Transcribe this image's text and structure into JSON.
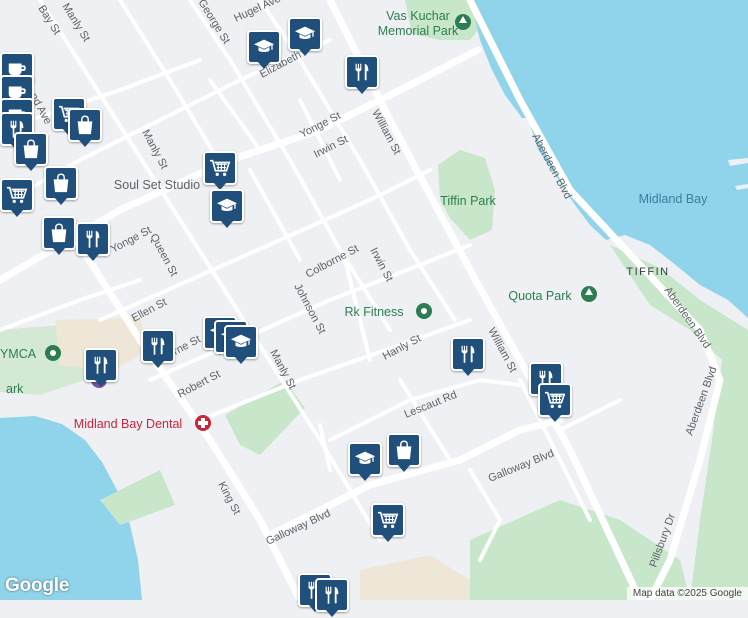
{
  "colors": {
    "water": "#8fd4ea",
    "park": "#c8e6c9",
    "land": "#eef0f3",
    "road": "#ffffff",
    "marker": "#1f4f7a",
    "poi_green": "#2e7d52",
    "poi_purple": "#7b4fa3",
    "poi_red": "#c5283d",
    "label_water": "#3b7ea1"
  },
  "streets": [
    {
      "name": "Bay St"
    },
    {
      "name": "Manly St"
    },
    {
      "name": "George St"
    },
    {
      "name": "Hugel Ave"
    },
    {
      "name": "Elizabeth"
    },
    {
      "name": "Yonge St"
    },
    {
      "name": "Irwin St"
    },
    {
      "name": "William St"
    },
    {
      "name": "Manly St"
    },
    {
      "name": "Queen St"
    },
    {
      "name": "Yonge St"
    },
    {
      "name": "Colborne St"
    },
    {
      "name": "Irwin St"
    },
    {
      "name": "Johnson St"
    },
    {
      "name": "Ellen St"
    },
    {
      "name": "Hanly St"
    },
    {
      "name": "William St"
    },
    {
      "name": "Manly St"
    },
    {
      "name": "Robert St"
    },
    {
      "name": "Lescaut Rd"
    },
    {
      "name": "Galloway Blvd"
    },
    {
      "name": "Galloway Blvd"
    },
    {
      "name": "King St"
    },
    {
      "name": "Aberdeen Blvd"
    },
    {
      "name": "Aberdeen Blvd"
    },
    {
      "name": "Aberdeen Blvd"
    },
    {
      "name": "Pillsbury Dr"
    },
    {
      "name": "land Ave"
    },
    {
      "name": "orne St"
    }
  ],
  "places": [
    {
      "name": "Vas Kuchar\nMemorial Park",
      "type": "park"
    },
    {
      "name": "Tiffin Park",
      "type": "park"
    },
    {
      "name": "Midland Bay",
      "type": "water"
    },
    {
      "name": "TIFFIN",
      "type": "area"
    },
    {
      "name": "Quota Park",
      "type": "park"
    },
    {
      "name": "Rk Fitness",
      "type": "gym"
    },
    {
      "name": "Soul Set Studio",
      "type": "business"
    },
    {
      "name": "YMCA",
      "type": "gym"
    },
    {
      "name": "Midland Bay Dental",
      "type": "dental"
    },
    {
      "name": "ark",
      "type": "park"
    }
  ],
  "markers": [
    {
      "icon": "school-icon"
    },
    {
      "icon": "school-icon"
    },
    {
      "icon": "restaurant-icon"
    },
    {
      "icon": "cafe-icon"
    },
    {
      "icon": "cafe-icon"
    },
    {
      "icon": "cafe-icon"
    },
    {
      "icon": "grocery-cart-icon"
    },
    {
      "icon": "shopping-bag-icon"
    },
    {
      "icon": "restaurant-icon"
    },
    {
      "icon": "shopping-bag-icon"
    },
    {
      "icon": "grocery-cart-icon"
    },
    {
      "icon": "shopping-bag-icon"
    },
    {
      "icon": "grocery-cart-icon"
    },
    {
      "icon": "school-icon"
    },
    {
      "icon": "shopping-bag-icon"
    },
    {
      "icon": "restaurant-icon"
    },
    {
      "icon": "restaurant-icon"
    },
    {
      "icon": "school-icon"
    },
    {
      "icon": "school-icon"
    },
    {
      "icon": "school-icon"
    },
    {
      "icon": "restaurant-icon"
    },
    {
      "icon": "restaurant-icon"
    },
    {
      "icon": "restaurant-icon"
    },
    {
      "icon": "grocery-cart-icon"
    },
    {
      "icon": "school-icon"
    },
    {
      "icon": "shopping-bag-icon"
    },
    {
      "icon": "grocery-cart-icon"
    },
    {
      "icon": "restaurant-icon"
    },
    {
      "icon": "restaurant-icon"
    }
  ],
  "branding": {
    "logo": "Google"
  },
  "attribution": "Map data ©2025 Google"
}
